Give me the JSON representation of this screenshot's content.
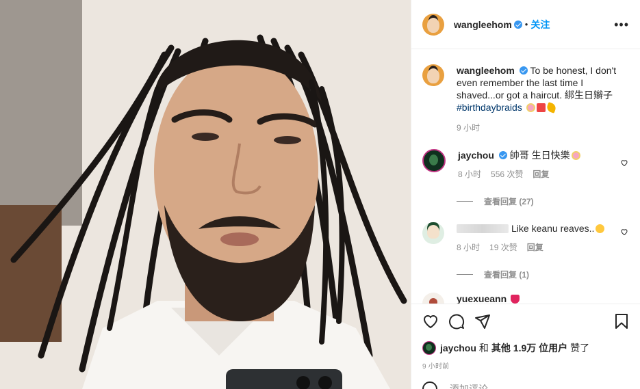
{
  "post": {
    "author": "wangleehom",
    "follow_label": "关注",
    "dot": "•",
    "more_label": "•••",
    "caption_text": "To be honest, I don't even remember the last time I shaved...or got a haircut. 綁生日辮子",
    "caption_hashtag": "#birthdaybraids",
    "caption_time": "9 小时"
  },
  "comments": [
    {
      "user": "jaychou",
      "verified": true,
      "text": "帥哥 生日快樂",
      "time": "8 小时",
      "likes": "556 次赞",
      "reply_label": "回复",
      "view_replies": "查看回复 (27)"
    },
    {
      "user": "",
      "verified": false,
      "text": "Like keanu reaves..",
      "time": "8 小时",
      "likes": "19 次赞",
      "reply_label": "回复",
      "view_replies": "查看回复 (1)"
    },
    {
      "user": "yuexueann",
      "verified": false,
      "text": ""
    }
  ],
  "likes_line": {
    "first_user": "jaychou",
    "connector": "和",
    "others": "其他 1.9万 位用户",
    "suffix": "赞了"
  },
  "post_time": "9 小时前",
  "add_comment_placeholder": "添加评论...",
  "icons": {
    "like": "heart-icon",
    "comment": "comment-icon",
    "share": "paper-plane-icon",
    "save": "bookmark-icon",
    "comment_like": "heart-outline-icon"
  },
  "colors": {
    "accent": "#0095f6",
    "verified": "#3897f0",
    "muted": "#8e8e8e",
    "text": "#262626"
  }
}
